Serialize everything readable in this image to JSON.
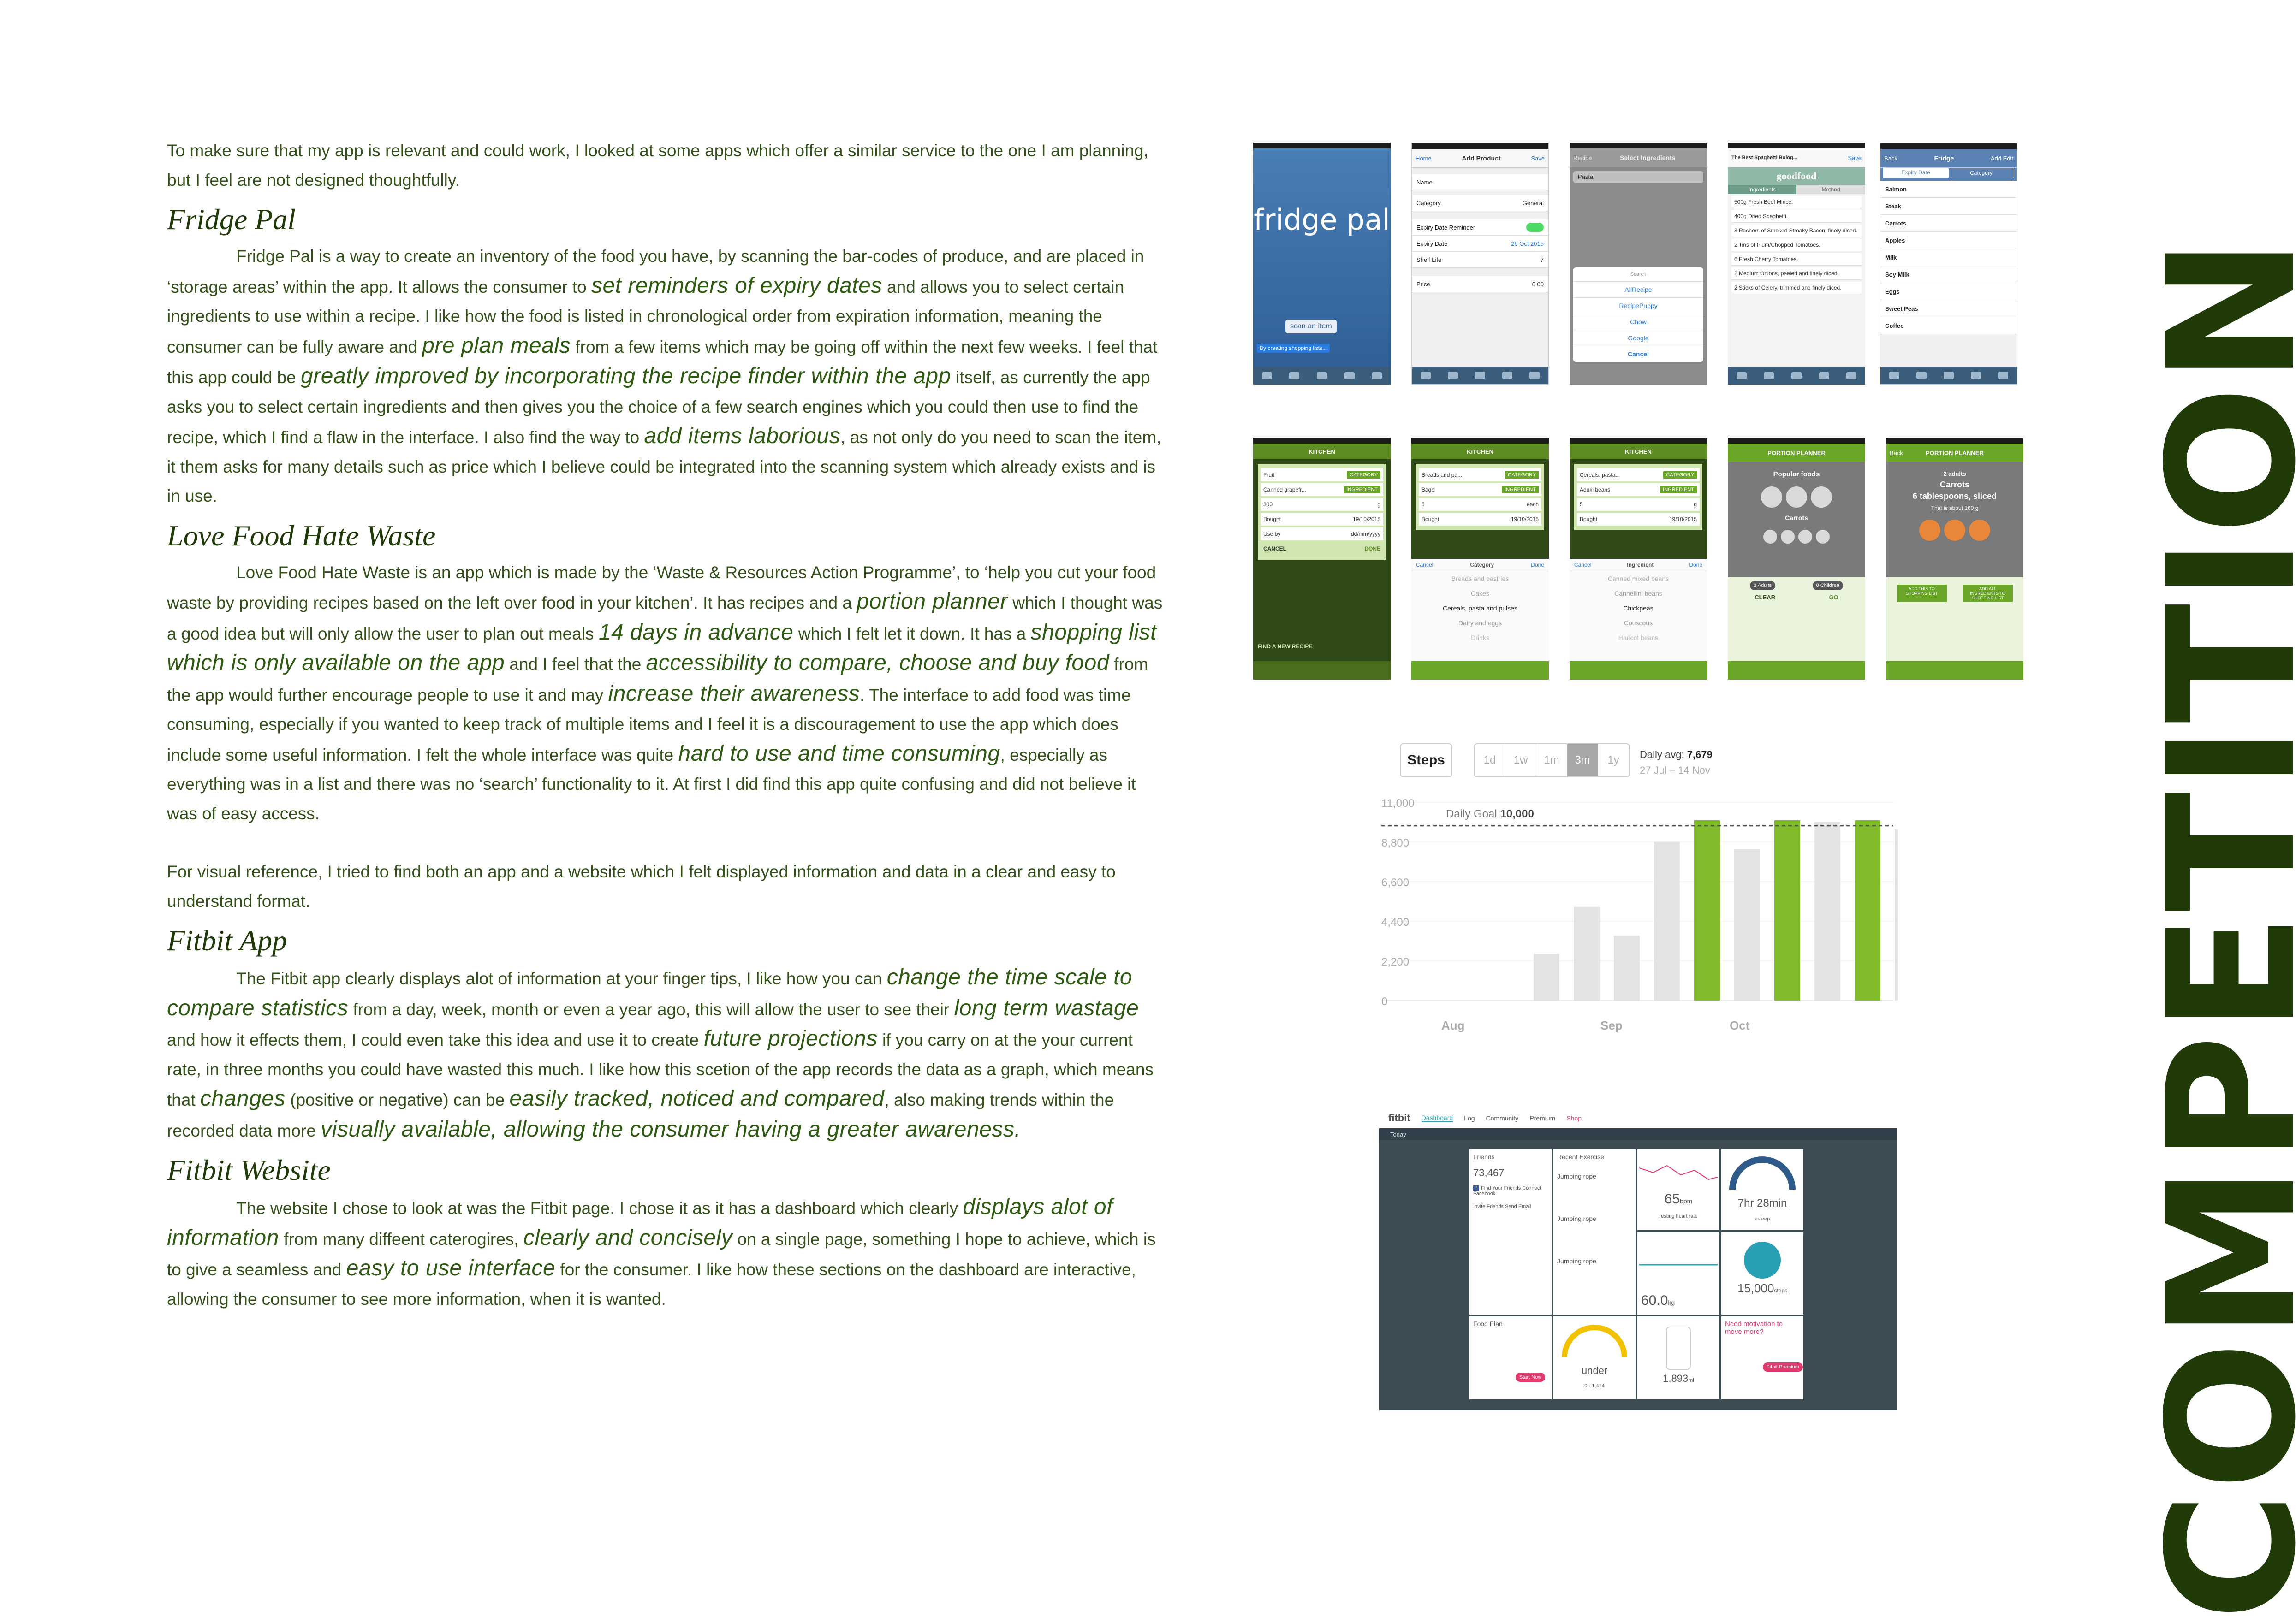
{
  "intro": "To make sure that my app is relevant and could work, I looked at some apps which offer a similar service to the one I am planning, but I feel are not designed thoughtfully.",
  "sections": {
    "fridge_pal": {
      "title": "Fridge Pal",
      "t1": "Fridge Pal is a way to create an inventory of the food you have, by scanning the bar-codes of produce, and are placed in ‘storage areas’ within the app. It allows the consumer to ",
      "e1": "set reminders of expiry dates",
      "t2": " and allows you to select certain ingredients to use within a recipe. I like how the food is listed in chronological order from expiration information, meaning the consumer can be fully aware and ",
      "e2": "pre plan meals",
      "t3": " from a few items which may be going off within the next few weeks. I feel that this app could be ",
      "e3": "greatly improved by incorporating the recipe finder within the app",
      "t4": " itself, as currently the app asks you to select certain ingredients and then gives you the choice of a few search engines which you could then use to find the recipe, which I find a flaw in the interface. I also find the way to ",
      "e4": "add items laborious",
      "t5": ", as not only do you need to scan the item, it them asks for many details such as price which I believe could be integrated into the scanning system which already exists and is in use."
    },
    "love_food": {
      "title": "Love Food Hate Waste",
      "t1": "Love Food Hate Waste is an app which is made by the ‘Waste & Resources Action Programme’, to ‘help you cut your food waste by providing recipes based on the left over food in your kitchen’. It has recipes and a ",
      "e1": "portion planner",
      "t2": " which I thought was a good idea but will only allow the user to plan out meals ",
      "e2": "14 days in advance",
      "t3": " which I felt let it down. It has a ",
      "e3": "shopping list which is only available on the app",
      "t4": " and I feel that the ",
      "e4": "accessibility to compare, choose and buy food",
      "t5": " from the app would further encourage people to use it and may ",
      "e5": "increase their awareness",
      "t6": ". The interface to add food was time consuming, especially if you wanted to keep track of multiple items and I feel it is a discouragement to use the app which does include some useful information. I felt the whole interface was quite ",
      "e6": "hard to use and time consuming",
      "t7": ", especially as everything was in a list and there was no ‘search’ functionality to it. At first I did find this app quite confusing and did not believe it was of easy access."
    },
    "visual_ref": "For visual reference, I tried to find both an app and a website which I felt displayed information and data in a clear and easy to understand format.",
    "fitbit_app": {
      "title": "Fitbit App",
      "t1": "The Fitbit app clearly displays alot of information at your finger tips, I like how you can ",
      "e1": "change the time scale to compare statistics",
      "t2": " from a day, week, month or even a year ago, this will allow the user to see their ",
      "e2": "long term wastage",
      "t3": " and how it effects them, I could even take this idea and use it to create ",
      "e3": "future projections",
      "t4": " if you carry on at the your current rate, in three months you could have wasted this much. I like how this scetion of the app records the data as a graph, which means that ",
      "e4": "changes",
      "t5": " (positive or negative) can be ",
      "e5": "easily tracked, noticed and compared",
      "t6": ", also making trends within the recorded data more ",
      "e6": "visually available, allowing the consumer having a greater awareness."
    },
    "fitbit_web": {
      "title": "Fitbit Website",
      "t1": "The website I chose to look at was the Fitbit page. I chose it as it has a dashboard which clearly ",
      "e1": "displays alot of information",
      "t2": " from many diffeent caterogires, ",
      "e2": "clearly and concisely",
      "t3": " on a single page, something I hope to achieve, which is to give a seamless and ",
      "e3": "easy to use interface",
      "t4": " for the consumer. I like how these sections on the dashboard are interactive, allowing the consumer to see more information, when it is wanted."
    }
  },
  "side_title": "COMPETITION",
  "screens": {
    "fridge_pal": {
      "logo": "fridge pal",
      "scan_btn": "scan an item",
      "tip": "By creating shopping lists..."
    },
    "add_product": {
      "back": "Home",
      "title": "Add Product",
      "save": "Save",
      "rows": [
        [
          "Name",
          ""
        ],
        [
          "Category",
          "General"
        ],
        [
          "Expiry Date Reminder",
          ""
        ],
        [
          "Expiry Date",
          "26 Oct 2015"
        ],
        [
          "Shelf Life",
          "7"
        ],
        [
          "Price",
          "0.00"
        ]
      ]
    },
    "select_ingredients": {
      "back": "Recipe",
      "title": "Select Ingredients",
      "search": "Pasta",
      "options": [
        "Search",
        "AllRecipe",
        "RecipePuppy",
        "Chow",
        "Google",
        "Cancel"
      ]
    },
    "goodfood": {
      "title": "The Best Spaghetti Bolog...",
      "save": "Save",
      "brand": "goodfood",
      "tabs": [
        "Ingredients",
        "Method"
      ],
      "items": [
        "500g Fresh Beef Mince.",
        "400g Dried Spaghetti.",
        "3 Rashers of Smoked Streaky Bacon, finely diced.",
        "2 Tins of Plum/Chopped Tomatoes.",
        "6 Fresh Cherry Tomatoes.",
        "2 Medium Onions, peeled and finely diced.",
        "2 Sticks of Celery, trimmed and finely diced."
      ]
    },
    "fridge_list": {
      "back": "Back",
      "title": "Fridge",
      "add": "Add",
      "edit": "Edit",
      "tabs": [
        "Expiry Date",
        "Category"
      ],
      "items": [
        "Salmon",
        "Steak",
        "Carrots",
        "Apples",
        "Milk",
        "Soy Milk",
        "Eggs",
        "Sweet Peas",
        "Coffee"
      ]
    },
    "kitchen1": {
      "title": "KITCHEN",
      "rows": [
        [
          "Fruit",
          "CATEGORY"
        ],
        [
          "Canned grapefr...",
          "INGREDIENT"
        ],
        [
          "300",
          "g"
        ],
        [
          "Bought",
          "19/10/2015"
        ],
        [
          "Use by",
          "dd/mm/yyyy"
        ]
      ],
      "cancel": "CANCEL",
      "done": "DONE",
      "find": "FIND A NEW RECIPE"
    },
    "kitchen2": {
      "title": "KITCHEN",
      "rows": [
        [
          "Breads and pa...",
          "CATEGORY"
        ],
        [
          "Bagel",
          "INGREDIENT"
        ],
        [
          "5",
          "each"
        ],
        [
          "Bought",
          "19/10/2015"
        ]
      ],
      "picker_cancel": "Cancel",
      "picker_title": "Category",
      "picker_done": "Done",
      "options": [
        "Breads and pastries",
        "Cakes",
        "Cereals, pasta and pulses",
        "Dairy and eggs",
        "Drinks"
      ]
    },
    "kitchen3": {
      "title": "KITCHEN",
      "rows": [
        [
          "Cereals, pasta...",
          "CATEGORY"
        ],
        [
          "Aduki beans",
          "INGREDIENT"
        ],
        [
          "5",
          "g"
        ],
        [
          "Bought",
          "19/10/2015"
        ]
      ],
      "picker_cancel": "Cancel",
      "picker_title": "Ingredient",
      "picker_done": "Done",
      "options": [
        "Canned mixed beans",
        "Cannellini beans",
        "Chickpeas",
        "Couscous",
        "Haricot beans"
      ]
    },
    "planner1": {
      "title": "PORTION PLANNER",
      "popular": "Popular foods",
      "food": "Carrots",
      "adults": "2 Adults",
      "children": "0 Children",
      "clear": "CLEAR",
      "go": "GO"
    },
    "planner2": {
      "back": "Back",
      "title": "PORTION PLANNER",
      "adults": "2 adults",
      "food": "Carrots",
      "portion": "6 tablespoons, sliced",
      "about": "That is about 160 g",
      "btn1": "ADD THIS TO SHOPPING LIST",
      "btn2": "ADD ALL INGREDIENTS TO SHOPPING LIST"
    }
  },
  "fitbit_chart": {
    "steps_label": "Steps",
    "ranges": [
      "1d",
      "1w",
      "1m",
      "3m",
      "1y"
    ],
    "selected_range": "3m",
    "avg_label": "Daily avg:",
    "avg_value": "7,679",
    "date_range": "27 Jul – 14 Nov",
    "goal_label": "Daily Goal",
    "goal_value": "10,000"
  },
  "chart_data": {
    "type": "bar",
    "ylim": [
      0,
      11000
    ],
    "yticks": [
      "11,000",
      "8,800",
      "6,600",
      "4,400",
      "2,200",
      "0"
    ],
    "xticks": [
      "Aug",
      "Sep",
      "Oct"
    ],
    "goal": 9700,
    "values": [
      2600,
      5200,
      3600,
      8800,
      10000,
      8400,
      10000,
      9900,
      10000,
      9500,
      7000
    ],
    "highlight": [
      false,
      false,
      false,
      false,
      true,
      false,
      true,
      false,
      true,
      false,
      false
    ],
    "colors": {
      "bar": "#e3e3e3",
      "highlight": "#7fbb2b"
    }
  },
  "fitbit_web": {
    "brand": "fitbit",
    "nav": [
      "Dashboard",
      "Log",
      "Community",
      "Premium",
      "Shop"
    ],
    "active": "Dashboard",
    "subheader": "Today",
    "tiles": {
      "friends": {
        "title": "Friends",
        "steps": "73,467",
        "fb_text": "Find Your Friends Connect Facebook",
        "invite": "Invite Friends Send Email"
      },
      "exercise": {
        "title": "Recent Exercise",
        "items": [
          "Jumping rope",
          "Jumping rope",
          "Jumping rope"
        ]
      },
      "heart": {
        "value": "65",
        "unit": "bpm",
        "label": "resting heart rate"
      },
      "sleep": {
        "value": "7hr 28min",
        "label": "asleep"
      },
      "weight": {
        "value": "60.0",
        "unit": "kg"
      },
      "calories": {
        "value": "15,000",
        "unit": "steps"
      },
      "food": {
        "title": "Food Plan",
        "btn": "Start Now"
      },
      "budget": {
        "label": "under",
        "a": "0",
        "b": "1,414"
      },
      "water": {
        "value": "1,893",
        "unit": "ml"
      },
      "premium": {
        "text": "Need motivation to move more?",
        "btn": "Fitbit Premium"
      }
    }
  }
}
